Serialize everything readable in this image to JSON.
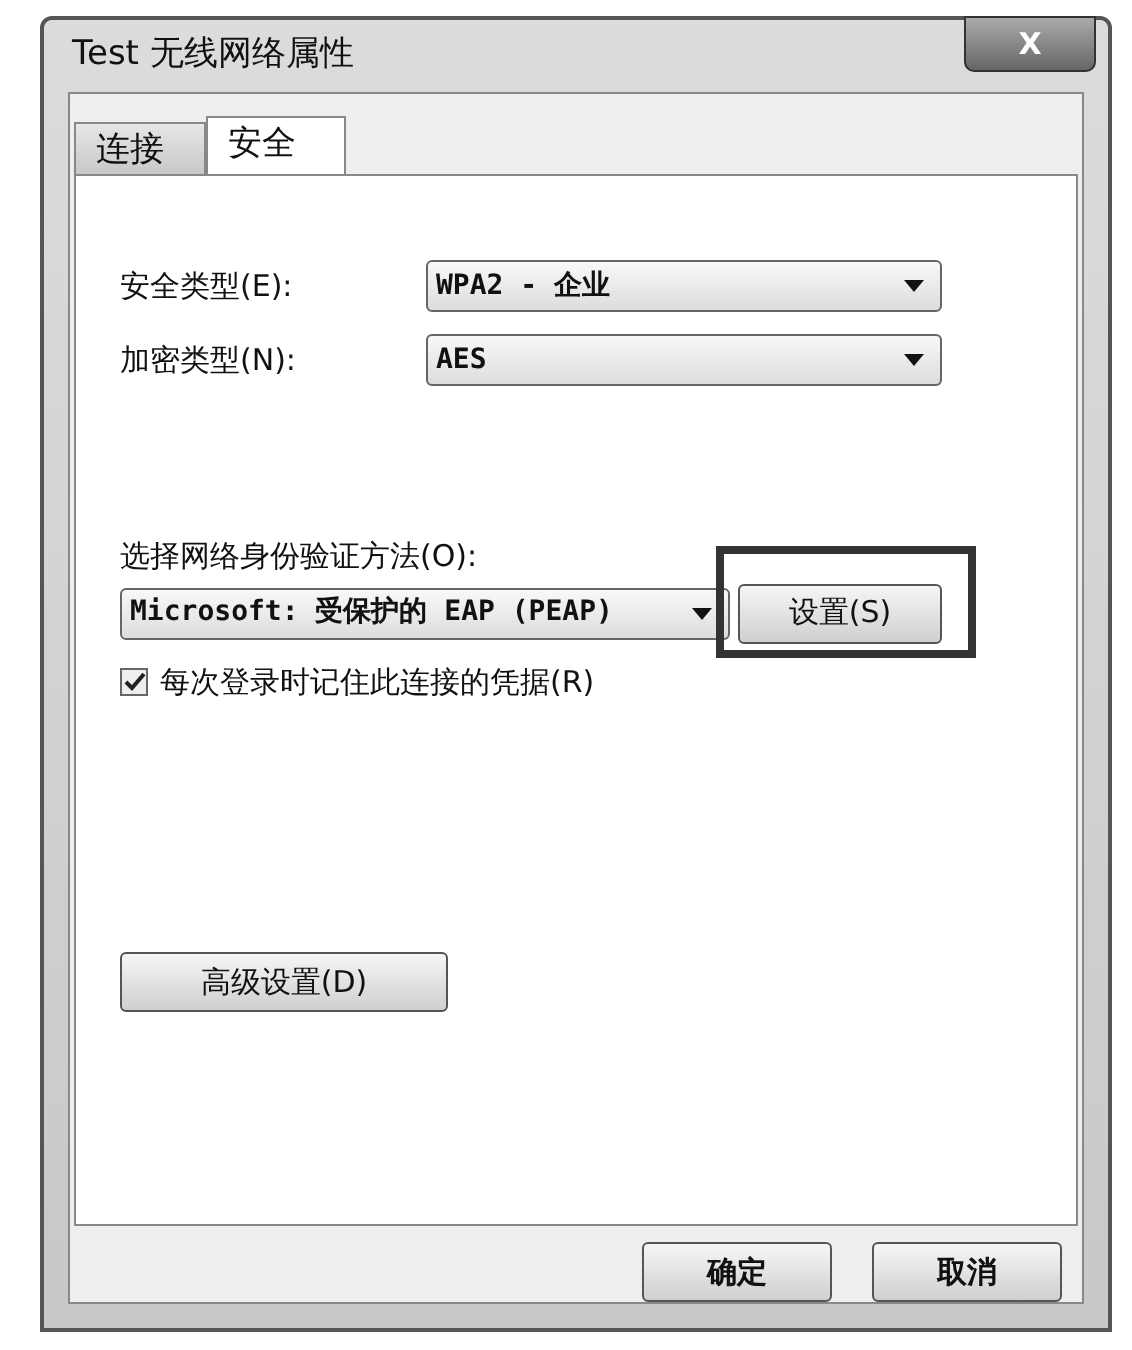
{
  "window": {
    "title": "Test 无线网络属性",
    "close": "X"
  },
  "tabs": [
    {
      "label": "连接",
      "selected": false
    },
    {
      "label": "安全",
      "selected": true
    }
  ],
  "fields": [
    {
      "label": "安全类型(E):",
      "value": "WPA2 - 企业"
    },
    {
      "label": "加密类型(N):",
      "value": "AES"
    }
  ],
  "auth": {
    "label": "选择网络身份验证方法(O):",
    "value": "Microsoft: 受保护的 EAP (PEAP)",
    "settings_button": "设置(S)",
    "highlighted": true
  },
  "remember": {
    "label": "每次登录时记住此连接的凭据(R)",
    "checked": true
  },
  "advanced_button": "高级设置(D)",
  "buttons": [
    "确定",
    "取消"
  ]
}
